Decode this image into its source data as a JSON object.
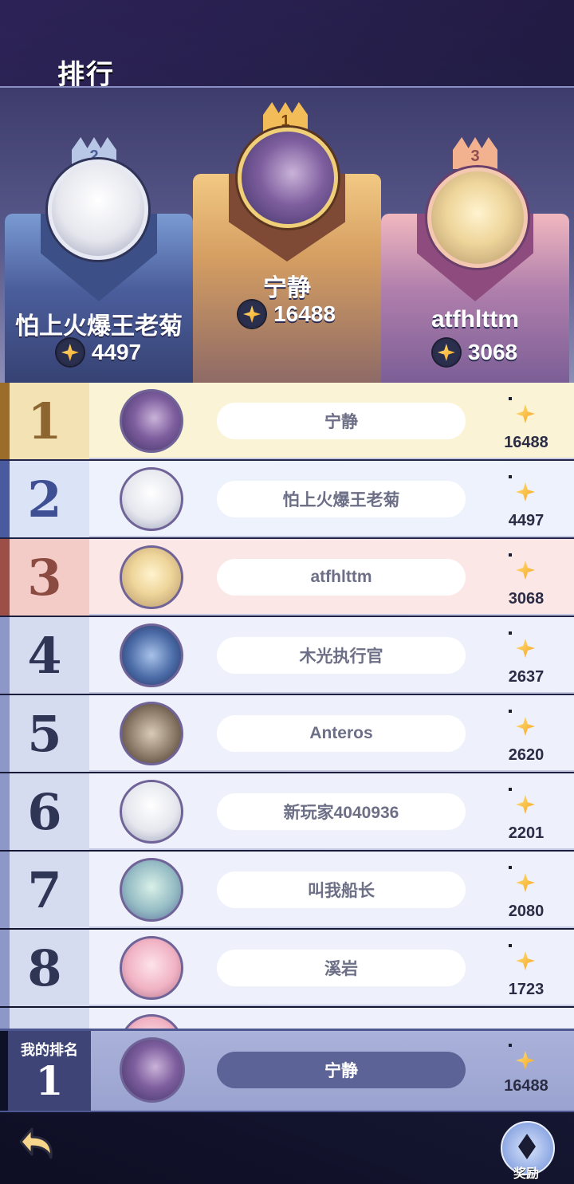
{
  "header": {
    "title": "排行"
  },
  "podium": [
    {
      "rank": "2",
      "name": "怕上火爆王老菊",
      "score": "4497"
    },
    {
      "rank": "1",
      "name": "宁静",
      "score": "16488"
    },
    {
      "rank": "3",
      "name": "atfhlttm",
      "score": "3068"
    }
  ],
  "ranking": [
    {
      "rank": "1",
      "name": "宁静",
      "score": "16488"
    },
    {
      "rank": "2",
      "name": "怕上火爆王老菊",
      "score": "4497"
    },
    {
      "rank": "3",
      "name": "atfhlttm",
      "score": "3068"
    },
    {
      "rank": "4",
      "name": "木光执行官",
      "score": "2637"
    },
    {
      "rank": "5",
      "name": "Anteros",
      "score": "2620"
    },
    {
      "rank": "6",
      "name": "新玩家4040936",
      "score": "2201"
    },
    {
      "rank": "7",
      "name": "叫我船长",
      "score": "2080"
    },
    {
      "rank": "8",
      "name": "溪岩",
      "score": "1723"
    }
  ],
  "my_rank": {
    "label": "我的排名",
    "rank": "1",
    "name": "宁静",
    "score": "16488"
  },
  "footer": {
    "reward_label": "奖励"
  },
  "icons": {
    "score": "star-coin-icon",
    "back": "back-arrow-icon",
    "reward": "diamond-icon"
  },
  "colors": {
    "gold": "#f2bd58",
    "silver": "#b8c7e6",
    "bronze": "#f2b18f",
    "accent": "#5c6396"
  }
}
